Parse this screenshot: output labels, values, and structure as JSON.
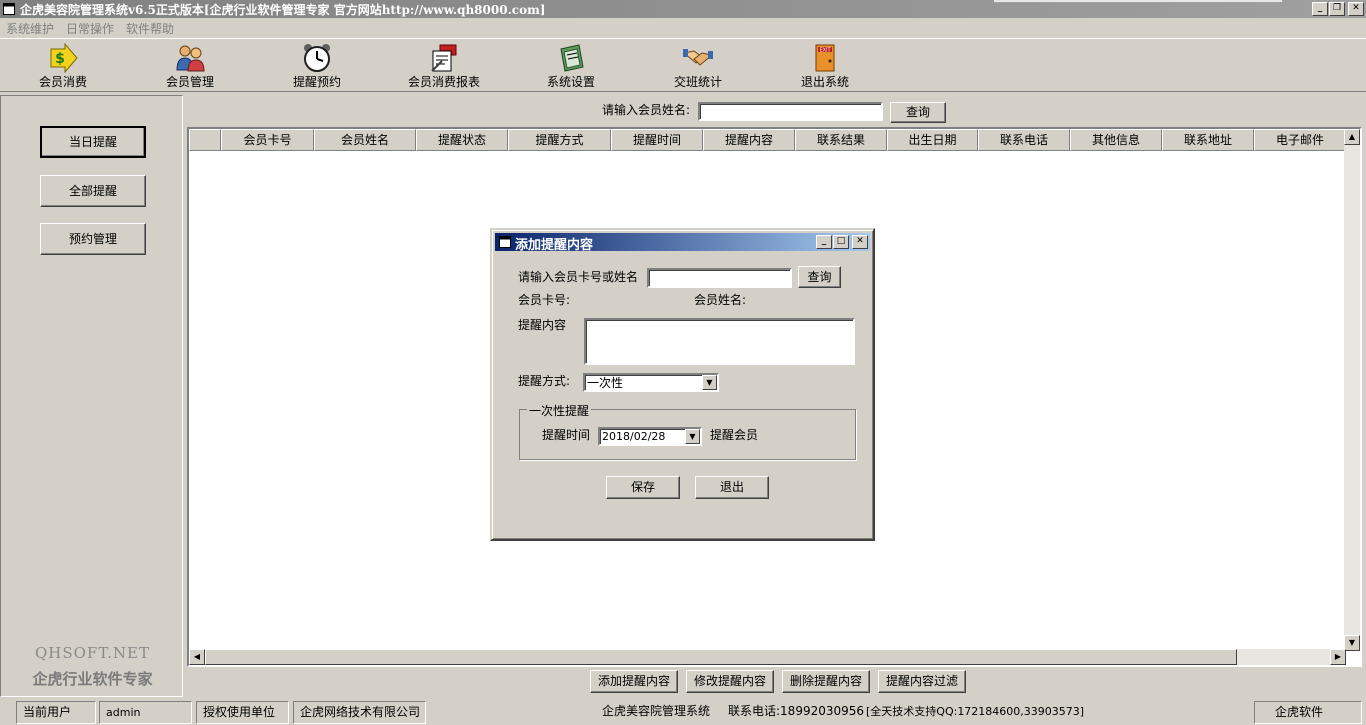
{
  "window": {
    "title": "企虎美容院管理系统v6.5正式版本[企虎行业软件管理专家 官方网站http://www.qh8000.com]"
  },
  "menu": [
    "系统维护",
    "日常操作",
    "软件帮助"
  ],
  "toolbar": [
    {
      "label": "会员消费",
      "icon": "dollar-arrow-icon"
    },
    {
      "label": "会员管理",
      "icon": "users-icon"
    },
    {
      "label": "提醒预约",
      "icon": "alarm-clock-icon"
    },
    {
      "label": "会员消费报表",
      "icon": "report-icon"
    },
    {
      "label": "系统设置",
      "icon": "settings-book-icon"
    },
    {
      "label": "交班统计",
      "icon": "handshake-icon"
    },
    {
      "label": "退出系统",
      "icon": "exit-door-icon"
    }
  ],
  "sidebar": {
    "buttons": [
      "当日提醒",
      "全部提醒",
      "预约管理"
    ],
    "brand_en": "QHSOFT.NET",
    "brand_cn": "企虎行业软件专家"
  },
  "search": {
    "label": "请输入会员姓名:",
    "value": "",
    "button": "查询"
  },
  "grid": {
    "columns": [
      "",
      "会员卡号",
      "会员姓名",
      "提醒状态",
      "提醒方式",
      "提醒时间",
      "提醒内容",
      "联系结果",
      "出生日期",
      "联系电话",
      "其他信息",
      "联系地址",
      "电子邮件"
    ],
    "rows": []
  },
  "actions": [
    "添加提醒内容",
    "修改提醒内容",
    "删除提醒内容",
    "提醒内容过滤"
  ],
  "statusbar": {
    "user_label": "当前用户",
    "user_value": "admin",
    "license_label": "授权使用单位",
    "license_value": "企虎网络技术有限公司",
    "system_name": "企虎美容院管理系统",
    "contact": "联系电话:18992030956",
    "support": "[全天技术支持QQ:172184600,33903573]",
    "vendor": "企虎软件"
  },
  "dialog": {
    "title": "添加提醒内容",
    "member_query_label": "请输入会员卡号或姓名",
    "member_query_value": "",
    "query_button": "查询",
    "card_label": "会员卡号:",
    "name_label": "会员姓名:",
    "content_label": "提醒内容",
    "content_value": "",
    "method_label": "提醒方式:",
    "method_value": "一次性",
    "group_title": "一次性提醒",
    "time_label": "提醒时间",
    "time_value": "2018/02/28",
    "remind_member_label": "提醒会员",
    "save_button": "保存",
    "exit_button": "退出"
  }
}
